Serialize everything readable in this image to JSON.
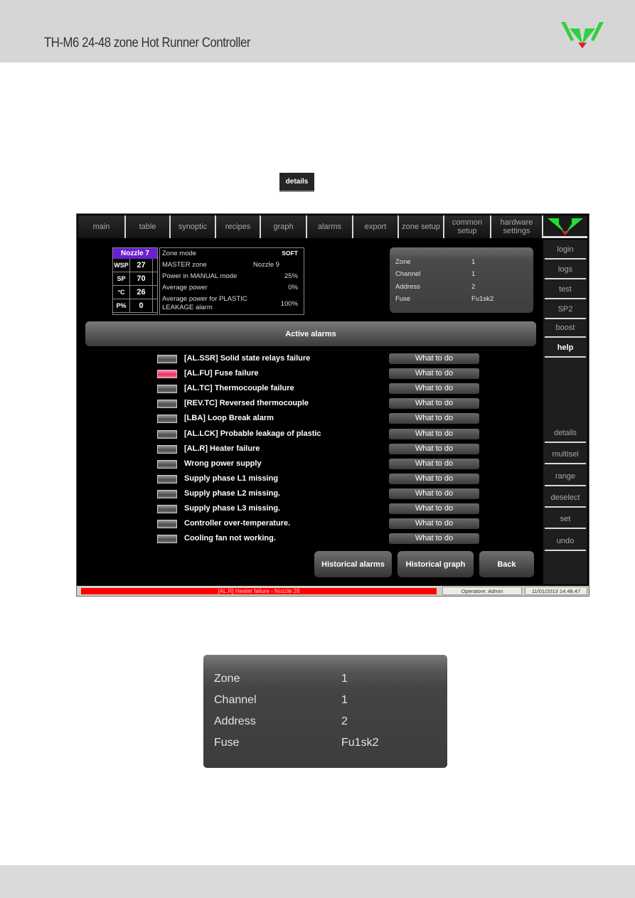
{
  "document": {
    "title": "TH-M6 24-48 zone Hot Runner Controller",
    "details_chip_label": "details"
  },
  "colors": {
    "header_bg": "#d6d6d6",
    "zone_title_bg": "#6a1fd0",
    "alarm_led_active": "#e0305e",
    "status_alarm_bg": "#ff0000",
    "logo_green": "#2fcf3f",
    "logo_red": "#e0202a"
  },
  "screen": {
    "top_tabs": [
      {
        "label": "main"
      },
      {
        "label": "table"
      },
      {
        "label": "synoptic"
      },
      {
        "label": "recipes"
      },
      {
        "label": "graph"
      },
      {
        "label": "alarms"
      },
      {
        "label": "export"
      },
      {
        "label": "zone setup"
      },
      {
        "label": "common setup"
      },
      {
        "label": "hardware settings"
      }
    ],
    "side_menu": [
      {
        "label": "login",
        "active": false
      },
      {
        "label": "logs",
        "active": false
      },
      {
        "label": "test",
        "active": false
      },
      {
        "label": "SP2",
        "active": false
      },
      {
        "label": "boost",
        "active": false
      },
      {
        "label": "help",
        "active": true
      },
      {
        "label": "details",
        "active": false
      },
      {
        "label": "multisel",
        "active": false
      },
      {
        "label": "range",
        "active": false
      },
      {
        "label": "deselect",
        "active": false
      },
      {
        "label": "set",
        "active": false
      },
      {
        "label": "undo",
        "active": false
      }
    ],
    "zone_card": {
      "title": "Nozzle 7",
      "rows": [
        {
          "key": "WSP",
          "value": "27"
        },
        {
          "key": "SP",
          "value": "70"
        },
        {
          "key": "°C",
          "value": "26"
        },
        {
          "key": "P%",
          "value": "0"
        }
      ]
    },
    "zone_settings": {
      "zone_mode_label": "Zone mode",
      "zone_mode_value": "SOFT",
      "master_zone_label": "MASTER zone",
      "master_zone_value": "Nozzle 9",
      "manual_power_label": "Power in MANUAL mode",
      "manual_power_value": "25%",
      "avg_power_label": "Average power",
      "avg_power_value": "0%",
      "leak_power_label_1": "Average power for PLASTIC",
      "leak_power_label_2": "LEAKAGE alarm",
      "leak_power_value": "100%"
    },
    "hardware_info": {
      "zone_label": "Zone",
      "zone_value": "1",
      "channel_label": "Channel",
      "channel_value": "1",
      "address_label": "Address",
      "address_value": "2",
      "fuse_label": "Fuse",
      "fuse_value": "Fu1sk2"
    },
    "active_alarms_title": "Active alarms",
    "what_to_do_label": "What to do",
    "alarms": [
      {
        "text": "[AL.SSR]  Solid state relays failure",
        "active": false
      },
      {
        "text": "[AL.FU]  Fuse failure",
        "active": true
      },
      {
        "text": "[AL.TC]  Thermocouple failure",
        "active": false
      },
      {
        "text": "[REV.TC]  Reversed thermocouple",
        "active": false
      },
      {
        "text": "[LBA]  Loop Break alarm",
        "active": false
      },
      {
        "text": "[AL.LCK]  Probable leakage of plastic",
        "active": false
      },
      {
        "text": "[AL.R]  Heater failure",
        "active": false
      },
      {
        "text": "Wrong power supply",
        "active": false
      },
      {
        "text": "Supply phase L1 missing",
        "active": false
      },
      {
        "text": "Supply phase L2 missing.",
        "active": false
      },
      {
        "text": "Supply phase L3 missing.",
        "active": false
      },
      {
        "text": "Controller over-temperature.",
        "active": false
      },
      {
        "text": "Cooling fan not working.",
        "active": false
      }
    ],
    "buttons": {
      "historical_alarms": "Historical alarms",
      "historical_graph": "Historical graph",
      "back": "Back"
    },
    "status_bar": {
      "alarm_message": "[AL.R]  Heater failure - Nozzle 28",
      "operator": "Operatore: Admin",
      "datetime": "11/01/2013  14.48.47"
    }
  },
  "zoomed_info": {
    "zone_label": "Zone",
    "zone_value": "1",
    "channel_label": "Channel",
    "channel_value": "1",
    "address_label": "Address",
    "address_value": "2",
    "fuse_label": "Fuse",
    "fuse_value": "Fu1sk2"
  }
}
